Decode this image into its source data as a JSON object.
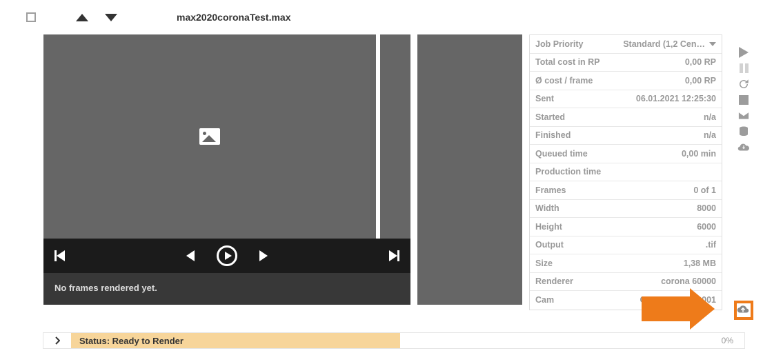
{
  "header": {
    "filename": "max2020coronaTest.max"
  },
  "preview": {
    "empty_msg": "No frames rendered yet."
  },
  "info": {
    "rows": [
      {
        "label": "Job Priority",
        "value": "Standard (1,2 Cen…",
        "dropdown": true
      },
      {
        "label": "Total cost in RP",
        "value": "0,00 RP"
      },
      {
        "label": "Ø cost / frame",
        "value": "0,00 RP"
      },
      {
        "label": "Sent",
        "value": "06.01.2021 12:25:30"
      },
      {
        "label": "Started",
        "value": "n/a"
      },
      {
        "label": "Finished",
        "value": "n/a"
      },
      {
        "label": "Queued time",
        "value": "0,00 min"
      },
      {
        "label": "Production time",
        "value": ""
      },
      {
        "label": "Frames",
        "value": "0 of 1"
      },
      {
        "label": "Width",
        "value": "8000"
      },
      {
        "label": "Height",
        "value": "6000"
      },
      {
        "label": "Output",
        "value": ".tif"
      },
      {
        "label": "Size",
        "value": "1,38 MB"
      },
      {
        "label": "Renderer",
        "value": "corona 60000"
      },
      {
        "label": "Cam",
        "value": "CoronaCamera001"
      }
    ]
  },
  "status": {
    "text": "Status: Ready to Render",
    "pct": "0%"
  }
}
